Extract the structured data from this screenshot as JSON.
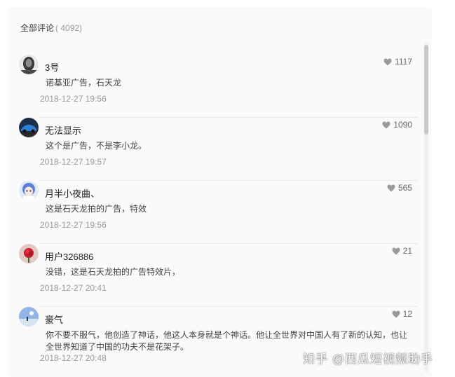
{
  "header": {
    "title": "全部评论",
    "count": "( 4092)"
  },
  "colors": {
    "panel_bg": "#fafafa",
    "divider": "#e9e9e9",
    "heart": "#9a9a9a",
    "time": "#999999"
  },
  "comments": [
    {
      "user": "3号",
      "text": "诺基亚广告，石天龙",
      "time": "2018-12-27 19:56",
      "likes": "1117",
      "avatar_icon": "dark-portrait-avatar"
    },
    {
      "user": "无法显示",
      "text": "这个是广告，不是李小龙。",
      "time": "2018-12-27 19:57",
      "likes": "1090",
      "avatar_icon": "blue-car-avatar"
    },
    {
      "user": "月半小夜曲、",
      "text": "这是石天龙拍的广告，特效",
      "time": "2018-12-27 19:56",
      "likes": "565",
      "avatar_icon": "anime-girl-avatar"
    },
    {
      "user": "用户326886",
      "text": "没错，这是石天龙拍的广告特效片，",
      "time": "2018-12-27 20:41",
      "likes": "21",
      "avatar_icon": "red-rose-avatar"
    },
    {
      "user": "豪气",
      "text": "你不要不服气，他创造了神话，他这人本身就是个神话。他让全世界对中国人有了新的认知，也让全世界知道了中国的功夫不是花架子。",
      "time": "2018-12-27 20:48",
      "likes": "12",
      "avatar_icon": "sky-landscape-avatar"
    }
  ],
  "watermark": "知乎 @西瓜短视频助手"
}
